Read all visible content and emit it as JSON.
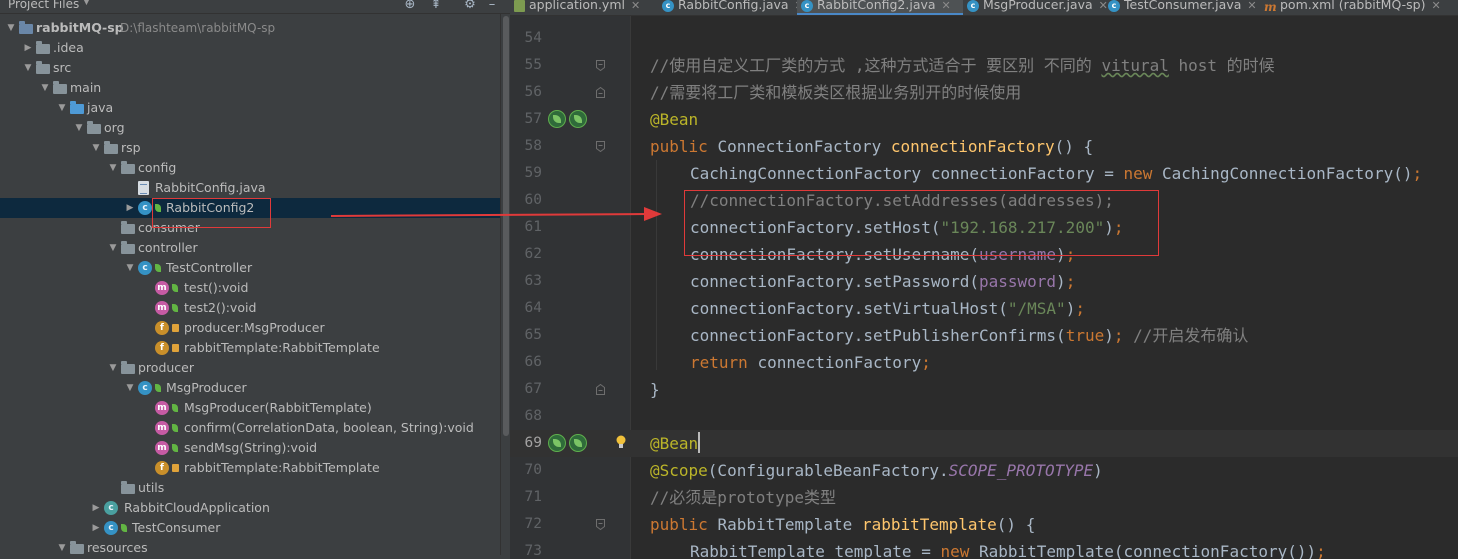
{
  "project_panel": {
    "title": "Project Files",
    "tree": [
      {
        "name": "tree-root-rabbitmq-sp",
        "depth": 0,
        "arrow": "down",
        "icon": "module",
        "label": "rabbitMQ-sp",
        "sub": "D:\\flashteam\\rabbitMQ-sp",
        "bold": true
      },
      {
        "name": "tree-folder-idea",
        "depth": 1,
        "arrow": "right",
        "icon": "folder",
        "label": ".idea"
      },
      {
        "name": "tree-folder-src",
        "depth": 1,
        "arrow": "down",
        "icon": "folder",
        "label": "src"
      },
      {
        "name": "tree-folder-main",
        "depth": 2,
        "arrow": "down",
        "icon": "folder",
        "label": "main"
      },
      {
        "name": "tree-folder-java",
        "depth": 3,
        "arrow": "down",
        "icon": "folder-blue",
        "label": "java"
      },
      {
        "name": "tree-package-org",
        "depth": 4,
        "arrow": "down",
        "icon": "folder",
        "label": "org"
      },
      {
        "name": "tree-package-rsp",
        "depth": 5,
        "arrow": "down",
        "icon": "folder",
        "label": "rsp"
      },
      {
        "name": "tree-package-config",
        "depth": 6,
        "arrow": "down",
        "icon": "folder",
        "label": "config"
      },
      {
        "name": "tree-file-rabbitconfig-java",
        "depth": 7,
        "arrow": "",
        "icon": "java-file",
        "label": "RabbitConfig.java"
      },
      {
        "name": "tree-class-rabbitconfig2",
        "depth": 7,
        "arrow": "right",
        "icon": "class-spring",
        "label": "RabbitConfig2",
        "selected": true
      },
      {
        "name": "tree-package-consumer",
        "depth": 6,
        "arrow": "",
        "icon": "folder",
        "label": "consumer"
      },
      {
        "name": "tree-package-controller",
        "depth": 6,
        "arrow": "down",
        "icon": "folder",
        "label": "controller"
      },
      {
        "name": "tree-class-testcontroller",
        "depth": 7,
        "arrow": "down",
        "icon": "class-spring",
        "label": "TestController"
      },
      {
        "name": "tree-method-test",
        "depth": 8,
        "arrow": "",
        "icon": "method",
        "label": "test():void"
      },
      {
        "name": "tree-method-test2",
        "depth": 8,
        "arrow": "",
        "icon": "method",
        "label": "test2():void"
      },
      {
        "name": "tree-field-producer",
        "depth": 8,
        "arrow": "",
        "icon": "field",
        "label": "producer:MsgProducer"
      },
      {
        "name": "tree-field-rabbittemplate-1",
        "depth": 8,
        "arrow": "",
        "icon": "field",
        "label": "rabbitTemplate:RabbitTemplate"
      },
      {
        "name": "tree-package-producer",
        "depth": 6,
        "arrow": "down",
        "icon": "folder",
        "label": "producer"
      },
      {
        "name": "tree-class-msgproducer",
        "depth": 7,
        "arrow": "down",
        "icon": "class-spring",
        "label": "MsgProducer"
      },
      {
        "name": "tree-method-msgproducer-ctor",
        "depth": 8,
        "arrow": "",
        "icon": "method",
        "label": "MsgProducer(RabbitTemplate)"
      },
      {
        "name": "tree-method-confirm",
        "depth": 8,
        "arrow": "",
        "icon": "method",
        "label": "confirm(CorrelationData, boolean, String):void"
      },
      {
        "name": "tree-method-sendmsg",
        "depth": 8,
        "arrow": "",
        "icon": "method",
        "label": "sendMsg(String):void"
      },
      {
        "name": "tree-field-rabbittemplate-2",
        "depth": 8,
        "arrow": "",
        "icon": "field",
        "label": "rabbitTemplate:RabbitTemplate"
      },
      {
        "name": "tree-package-utils",
        "depth": 6,
        "arrow": "",
        "icon": "folder",
        "label": "utils"
      },
      {
        "name": "tree-class-rabbitcloudapplication",
        "depth": 5,
        "arrow": "right",
        "icon": "class-app",
        "label": "RabbitCloudApplication"
      },
      {
        "name": "tree-class-testconsumer",
        "depth": 5,
        "arrow": "right",
        "icon": "class-spring",
        "label": "TestConsumer"
      },
      {
        "name": "tree-folder-resources",
        "depth": 3,
        "arrow": "down",
        "icon": "folder",
        "label": "resources"
      }
    ]
  },
  "tabs": [
    {
      "label": "application.yml",
      "icon": "yml-file-icon",
      "active": false
    },
    {
      "label": "RabbitConfig.java",
      "icon": "class-icon",
      "active": false
    },
    {
      "label": "RabbitConfig2.java",
      "icon": "class-icon",
      "active": true
    },
    {
      "label": "MsgProducer.java",
      "icon": "class-icon",
      "active": false
    },
    {
      "label": "TestConsumer.java",
      "icon": "class-icon",
      "active": false
    },
    {
      "label": "pom.xml (rabbitMQ-sp)",
      "icon": "maven-icon",
      "active": false
    }
  ],
  "editor": {
    "current_line": 69,
    "lines": [
      {
        "num": "54",
        "tokens": []
      },
      {
        "num": "55",
        "tokens": [
          [
            "ind1",
            ""
          ],
          [
            "c",
            "//使用自定义工厂类的方式 ,这种方式适合于 要区别 不同的 "
          ],
          [
            "cw",
            "vitural"
          ],
          [
            "c",
            " host 的时候"
          ]
        ],
        "fold": "open"
      },
      {
        "num": "56",
        "tokens": [
          [
            "ind1",
            ""
          ],
          [
            "c",
            "//需要将工厂类和模板类区根据业务别开的时候使用"
          ]
        ],
        "fold": "close"
      },
      {
        "num": "57",
        "tokens": [
          [
            "ind1",
            ""
          ],
          [
            "a",
            "@Bean"
          ]
        ],
        "gutter": "bean"
      },
      {
        "num": "58",
        "tokens": [
          [
            "ind1",
            ""
          ],
          [
            "k",
            "public "
          ],
          [
            "t",
            "ConnectionFactory "
          ],
          [
            "f",
            "connectionFactory"
          ],
          [
            "t",
            "() {"
          ]
        ],
        "fold": "open"
      },
      {
        "num": "59",
        "tokens": [
          [
            "ind2",
            ""
          ],
          [
            "t",
            "CachingConnectionFactory connectionFactory = "
          ],
          [
            "k",
            "new "
          ],
          [
            "t",
            "CachingConnectionFactory()"
          ],
          [
            "k",
            ";"
          ]
        ]
      },
      {
        "num": "60",
        "tokens": [
          [
            "ind2",
            ""
          ],
          [
            "c",
            "//connectionFactory.setAddresses(addresses);"
          ]
        ]
      },
      {
        "num": "61",
        "tokens": [
          [
            "ind2",
            ""
          ],
          [
            "t",
            "connectionFactory.setHost("
          ],
          [
            "s",
            "\"192.168.217.200\""
          ],
          [
            "t",
            ")"
          ],
          [
            "k",
            ";"
          ]
        ]
      },
      {
        "num": "62",
        "tokens": [
          [
            "ind2",
            ""
          ],
          [
            "t",
            "connectionFactory.setUsername("
          ],
          [
            "p",
            "username"
          ],
          [
            "t",
            ")"
          ],
          [
            "k",
            ";"
          ]
        ]
      },
      {
        "num": "63",
        "tokens": [
          [
            "ind2",
            ""
          ],
          [
            "t",
            "connectionFactory.setPassword("
          ],
          [
            "p",
            "password"
          ],
          [
            "t",
            ")"
          ],
          [
            "k",
            ";"
          ]
        ]
      },
      {
        "num": "64",
        "tokens": [
          [
            "ind2",
            ""
          ],
          [
            "t",
            "connectionFactory.setVirtualHost("
          ],
          [
            "s",
            "\"/MSA\""
          ],
          [
            "t",
            ")"
          ],
          [
            "k",
            ";"
          ]
        ]
      },
      {
        "num": "65",
        "tokens": [
          [
            "ind2",
            ""
          ],
          [
            "t",
            "connectionFactory.setPublisherConfirms("
          ],
          [
            "k",
            "true"
          ],
          [
            "t",
            ")"
          ],
          [
            "k",
            "; "
          ],
          [
            "c",
            "//开启发布确认"
          ]
        ]
      },
      {
        "num": "66",
        "tokens": [
          [
            "ind2",
            ""
          ],
          [
            "k",
            "return "
          ],
          [
            "t",
            "connectionFactory"
          ],
          [
            "k",
            ";"
          ]
        ]
      },
      {
        "num": "67",
        "tokens": [
          [
            "ind1",
            ""
          ],
          [
            "t",
            "}"
          ]
        ],
        "fold": "close"
      },
      {
        "num": "68",
        "tokens": []
      },
      {
        "num": "69",
        "tokens": [
          [
            "ind1",
            ""
          ],
          [
            "a",
            "@Bean"
          ]
        ],
        "gutter": "bean",
        "bulb": true,
        "current": true
      },
      {
        "num": "70",
        "tokens": [
          [
            "ind1",
            ""
          ],
          [
            "a",
            "@Scope"
          ],
          [
            "t",
            "(ConfigurableBeanFactory."
          ],
          [
            "ic",
            "SCOPE_PROTOTYPE"
          ],
          [
            "t",
            ")"
          ]
        ]
      },
      {
        "num": "71",
        "tokens": [
          [
            "ind1",
            ""
          ],
          [
            "c",
            "//必须是prototype类型"
          ]
        ]
      },
      {
        "num": "72",
        "tokens": [
          [
            "ind1",
            ""
          ],
          [
            "k",
            "public "
          ],
          [
            "t",
            "RabbitTemplate "
          ],
          [
            "f",
            "rabbitTemplate"
          ],
          [
            "t",
            "() {"
          ]
        ],
        "fold": "open"
      },
      {
        "num": "73",
        "tokens": [
          [
            "ind2",
            ""
          ],
          [
            "t",
            "RabbitTemplate template = "
          ],
          [
            "k",
            "new "
          ],
          [
            "t",
            "RabbitTemplate(connectionFactory())"
          ],
          [
            "k",
            ";"
          ]
        ]
      }
    ]
  },
  "colors": {
    "annotation_red": "#e03a3a",
    "keyword": "#cc7832",
    "string": "#6a8759",
    "comment": "#808080",
    "annotation": "#bbb529",
    "method_decl": "#ffc66d",
    "field": "#9876aa"
  }
}
